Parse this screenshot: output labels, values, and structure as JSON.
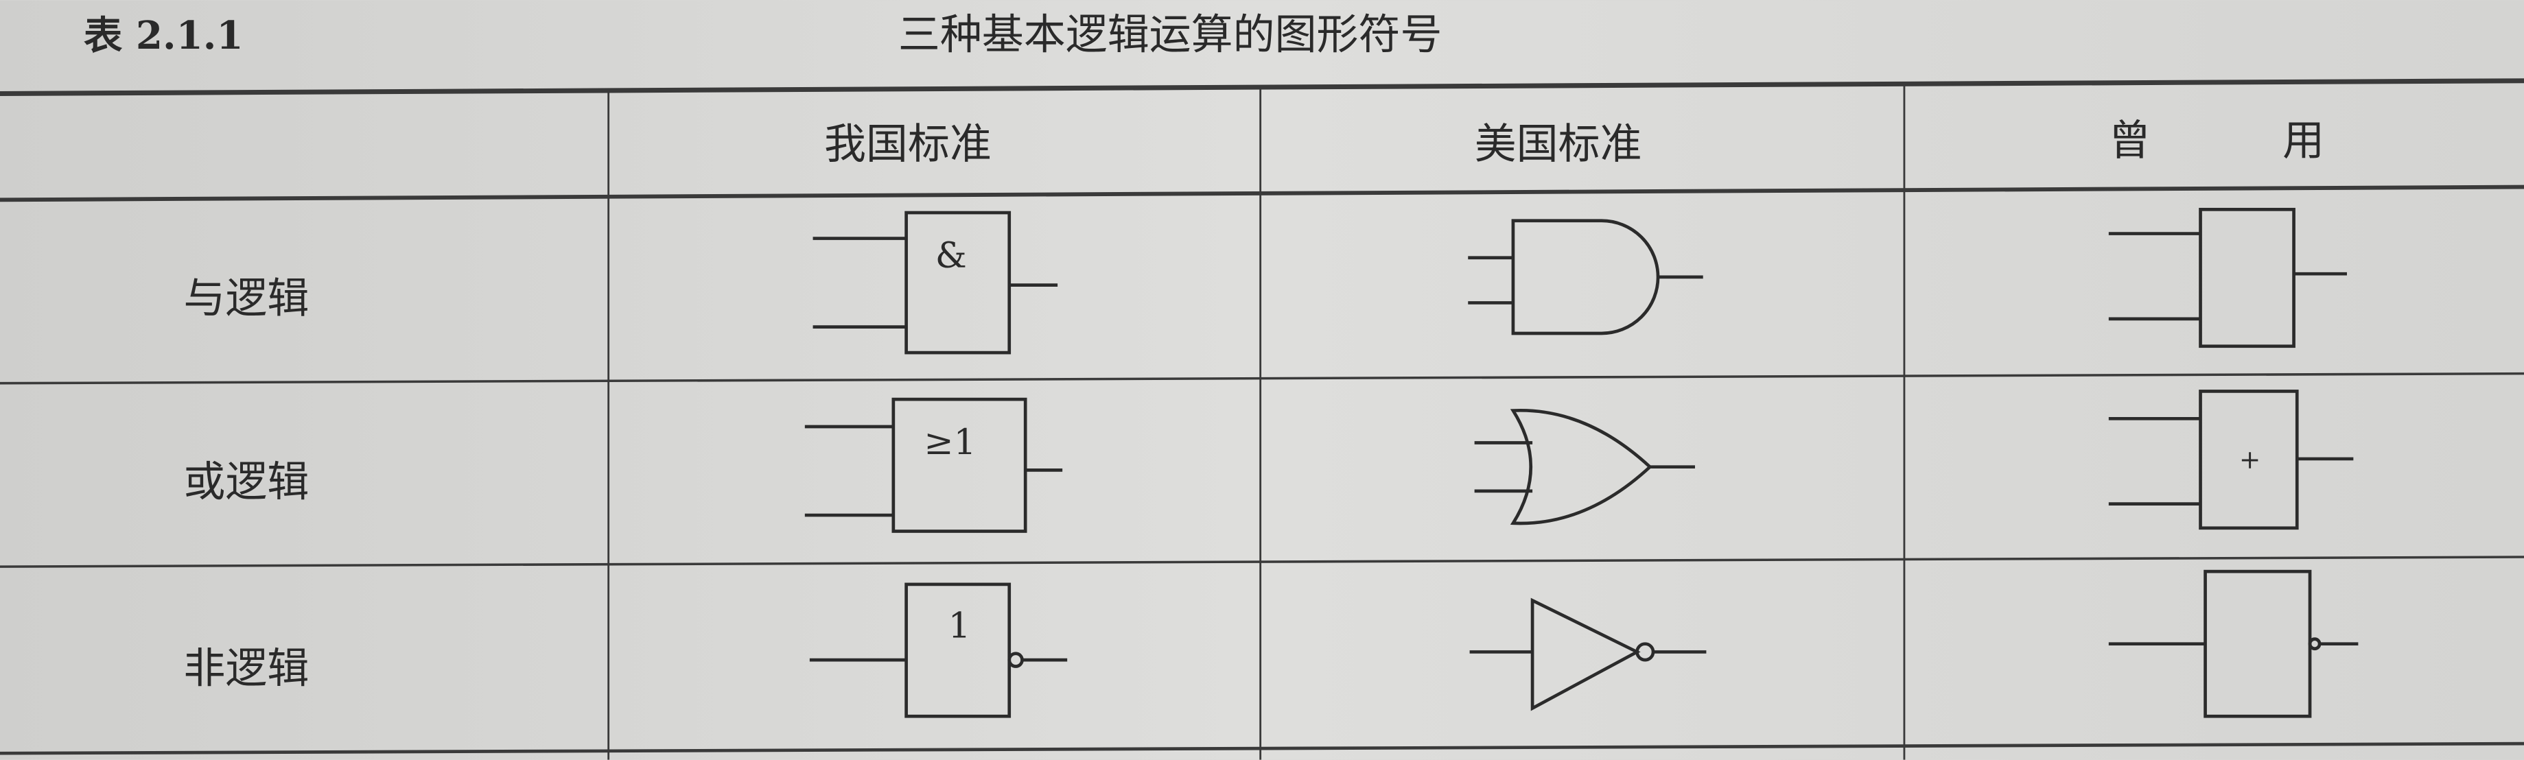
{
  "caption": {
    "number": "表 2.1.1",
    "title": "三种基本逻辑运算的图形符号"
  },
  "table": {
    "headers": [
      "",
      "我国标准",
      "美国标准",
      "曾",
      "用"
    ],
    "rows": [
      {
        "label": "与逻辑",
        "cn_symbol_text": "&",
        "old_symbol_text": ""
      },
      {
        "label": "或逻辑",
        "cn_symbol_text": "≥1",
        "old_symbol_text": "+"
      },
      {
        "label": "非逻辑",
        "cn_symbol_text": "1",
        "old_symbol_text": ""
      }
    ]
  }
}
